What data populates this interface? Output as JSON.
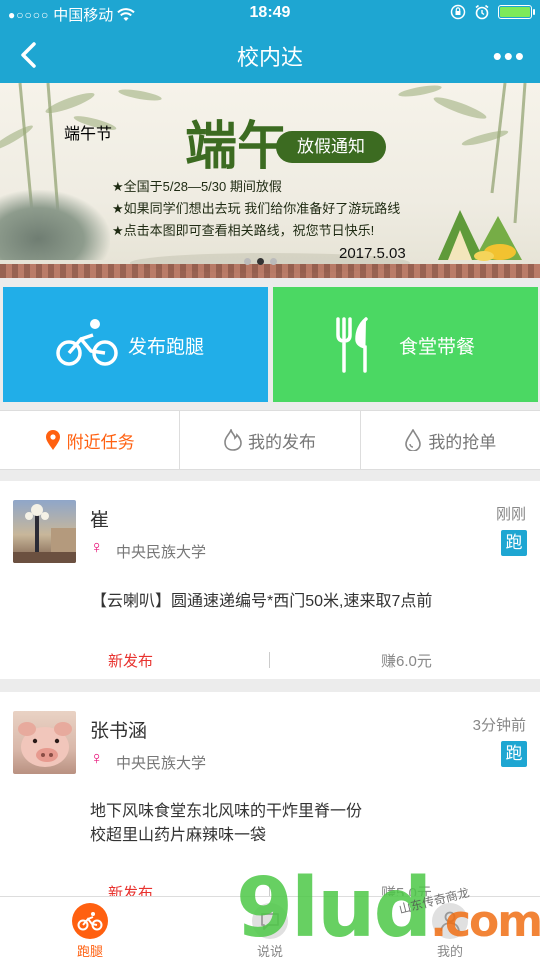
{
  "status_bar": {
    "signal_dots": "●○○○○",
    "carrier": "中国移动",
    "time": "18:49",
    "icons": [
      "wifi-icon",
      "orientation-lock-icon",
      "alarm-icon",
      "battery-icon"
    ]
  },
  "nav": {
    "title": "校内达",
    "back_icon": "chevron-left-icon",
    "more_label": "•••"
  },
  "banner": {
    "title": "端午",
    "subtitle": "放假通知",
    "seal_text": "端午节",
    "lines": [
      "★全国于5/28—5/30 期间放假",
      "★如果同学们想出去玩 我们给你准备好了游玩路线",
      "★点击本图即可查看相关路线，祝您节日快乐!"
    ],
    "date": "2017.5.03",
    "pages": 3,
    "active_page": 2
  },
  "actions": [
    {
      "label": "发布跑腿",
      "icon": "bicycle-icon",
      "color": "#21aee8"
    },
    {
      "label": "食堂带餐",
      "icon": "fork-knife-icon",
      "color": "#4bd863"
    }
  ],
  "tabs": [
    {
      "label": "附近任务",
      "icon": "location-pin-icon",
      "active": true
    },
    {
      "label": "我的发布",
      "icon": "flame-icon",
      "active": false
    },
    {
      "label": "我的抢单",
      "icon": "water-drop-icon",
      "active": false
    }
  ],
  "tasks": [
    {
      "name": "崔",
      "gender": "♀",
      "school": "中央民族大学",
      "time": "刚刚",
      "badge": "跑",
      "desc": [
        "【云喇叭】圆通速递编号*西门50米,速来取7点前"
      ],
      "status": "新发布",
      "earn": "赚6.0元"
    },
    {
      "name": "张书涵",
      "gender": "♀",
      "school": "中央民族大学",
      "time": "3分钟前",
      "badge": "跑",
      "desc": [
        "地下风味食堂东北风味的干炸里脊一份",
        "校超里山药片麻辣味一袋"
      ],
      "status": "新发布",
      "earn": "赚5.0元"
    }
  ],
  "bottom_nav": [
    {
      "label": "跑腿",
      "icon": "bicycle-icon",
      "active": true
    },
    {
      "label": "说说",
      "icon": "chat-icon",
      "active": false
    },
    {
      "label": "我的",
      "icon": "person-icon",
      "active": false
    }
  ],
  "watermark": {
    "text": "9lud",
    "dot": ".com",
    "sub": "山东传奇商龙"
  },
  "colors": {
    "brand": "#1ea6d2",
    "run_tile": "#21aee8",
    "food_tile": "#4bd863",
    "active_orange": "#ff6010",
    "new_red": "#e8322e",
    "gender_pink": "#e8157a"
  }
}
